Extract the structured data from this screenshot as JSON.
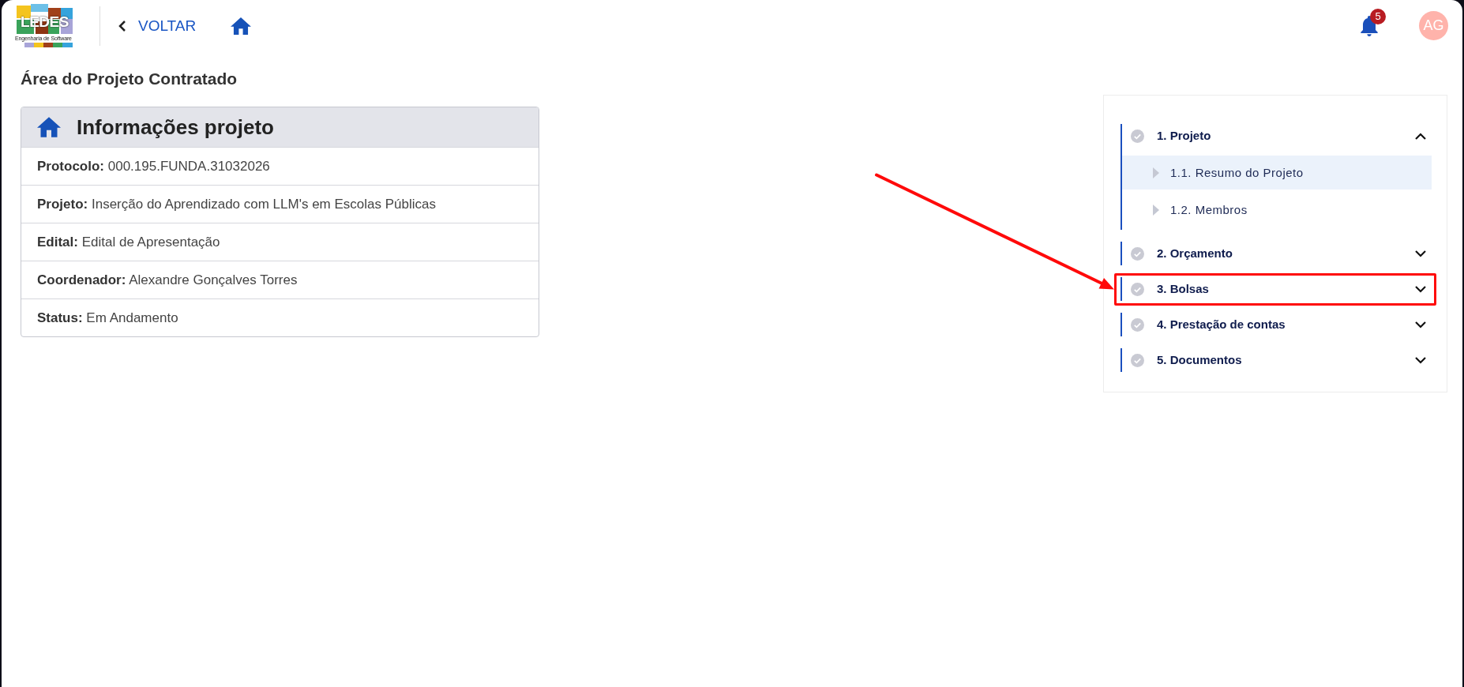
{
  "header": {
    "logo": {
      "title": "LEDES",
      "subtitle": "Engenharia de Software"
    },
    "back_link": "VOLTAR",
    "notifications": {
      "count": "5"
    },
    "avatar": {
      "initials": "AG"
    }
  },
  "page_title": "Área do Projeto Contratado",
  "info_card": {
    "title": "Informações projeto",
    "rows": [
      "**Protocolo:** 000.195.FUNDA.31032026",
      "**Projeto:** Inserção do Aprendizado com LLM's em Escolas Públicas",
      "**Edital:** Edital de Apresentação",
      "**Coordenador:** Alexandre Gonçalves Torres",
      "**Status:** Em Andamento"
    ]
  },
  "steps": [
    {
      "label": "1. Projeto",
      "expanded": true,
      "highlighted": false,
      "children": [
        {
          "label": "1.1. Resumo do Projeto",
          "selected": true
        },
        {
          "label": "1.2. Membros",
          "selected": false
        }
      ]
    },
    {
      "label": "2. Orçamento",
      "expanded": false,
      "highlighted": false
    },
    {
      "label": "3. Bolsas",
      "expanded": false,
      "highlighted": true
    },
    {
      "label": "4. Prestação de contas",
      "expanded": false,
      "highlighted": false
    },
    {
      "label": "5. Documentos",
      "expanded": false,
      "highlighted": false
    }
  ]
}
